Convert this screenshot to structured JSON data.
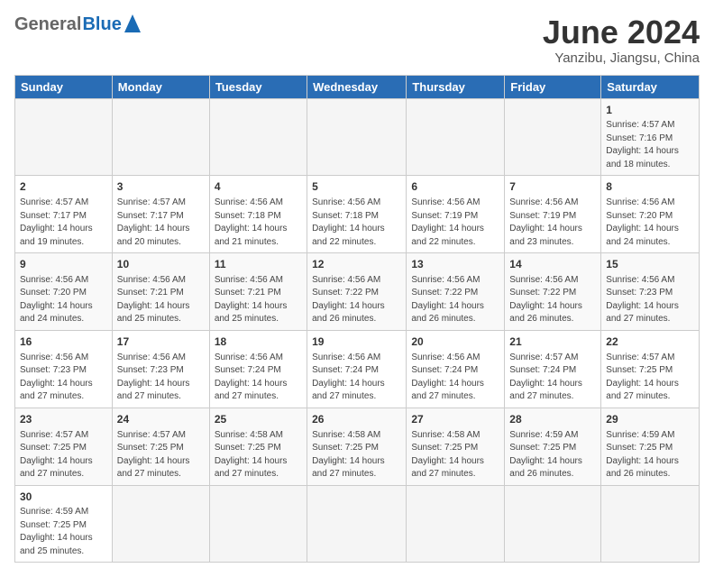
{
  "header": {
    "logo_general": "General",
    "logo_blue": "Blue",
    "title": "June 2024",
    "location": "Yanzibu, Jiangsu, China"
  },
  "days_of_week": [
    "Sunday",
    "Monday",
    "Tuesday",
    "Wednesday",
    "Thursday",
    "Friday",
    "Saturday"
  ],
  "weeks": [
    {
      "days": [
        {
          "num": "",
          "info": ""
        },
        {
          "num": "",
          "info": ""
        },
        {
          "num": "",
          "info": ""
        },
        {
          "num": "",
          "info": ""
        },
        {
          "num": "",
          "info": ""
        },
        {
          "num": "",
          "info": ""
        },
        {
          "num": "1",
          "info": "Sunrise: 4:57 AM\nSunset: 7:16 PM\nDaylight: 14 hours\nand 18 minutes."
        }
      ]
    },
    {
      "days": [
        {
          "num": "2",
          "info": "Sunrise: 4:57 AM\nSunset: 7:17 PM\nDaylight: 14 hours\nand 19 minutes."
        },
        {
          "num": "3",
          "info": "Sunrise: 4:57 AM\nSunset: 7:17 PM\nDaylight: 14 hours\nand 20 minutes."
        },
        {
          "num": "4",
          "info": "Sunrise: 4:56 AM\nSunset: 7:18 PM\nDaylight: 14 hours\nand 21 minutes."
        },
        {
          "num": "5",
          "info": "Sunrise: 4:56 AM\nSunset: 7:18 PM\nDaylight: 14 hours\nand 22 minutes."
        },
        {
          "num": "6",
          "info": "Sunrise: 4:56 AM\nSunset: 7:19 PM\nDaylight: 14 hours\nand 22 minutes."
        },
        {
          "num": "7",
          "info": "Sunrise: 4:56 AM\nSunset: 7:19 PM\nDaylight: 14 hours\nand 23 minutes."
        },
        {
          "num": "8",
          "info": "Sunrise: 4:56 AM\nSunset: 7:20 PM\nDaylight: 14 hours\nand 24 minutes."
        }
      ]
    },
    {
      "days": [
        {
          "num": "9",
          "info": "Sunrise: 4:56 AM\nSunset: 7:20 PM\nDaylight: 14 hours\nand 24 minutes."
        },
        {
          "num": "10",
          "info": "Sunrise: 4:56 AM\nSunset: 7:21 PM\nDaylight: 14 hours\nand 25 minutes."
        },
        {
          "num": "11",
          "info": "Sunrise: 4:56 AM\nSunset: 7:21 PM\nDaylight: 14 hours\nand 25 minutes."
        },
        {
          "num": "12",
          "info": "Sunrise: 4:56 AM\nSunset: 7:22 PM\nDaylight: 14 hours\nand 26 minutes."
        },
        {
          "num": "13",
          "info": "Sunrise: 4:56 AM\nSunset: 7:22 PM\nDaylight: 14 hours\nand 26 minutes."
        },
        {
          "num": "14",
          "info": "Sunrise: 4:56 AM\nSunset: 7:22 PM\nDaylight: 14 hours\nand 26 minutes."
        },
        {
          "num": "15",
          "info": "Sunrise: 4:56 AM\nSunset: 7:23 PM\nDaylight: 14 hours\nand 27 minutes."
        }
      ]
    },
    {
      "days": [
        {
          "num": "16",
          "info": "Sunrise: 4:56 AM\nSunset: 7:23 PM\nDaylight: 14 hours\nand 27 minutes."
        },
        {
          "num": "17",
          "info": "Sunrise: 4:56 AM\nSunset: 7:23 PM\nDaylight: 14 hours\nand 27 minutes."
        },
        {
          "num": "18",
          "info": "Sunrise: 4:56 AM\nSunset: 7:24 PM\nDaylight: 14 hours\nand 27 minutes."
        },
        {
          "num": "19",
          "info": "Sunrise: 4:56 AM\nSunset: 7:24 PM\nDaylight: 14 hours\nand 27 minutes."
        },
        {
          "num": "20",
          "info": "Sunrise: 4:56 AM\nSunset: 7:24 PM\nDaylight: 14 hours\nand 27 minutes."
        },
        {
          "num": "21",
          "info": "Sunrise: 4:57 AM\nSunset: 7:24 PM\nDaylight: 14 hours\nand 27 minutes."
        },
        {
          "num": "22",
          "info": "Sunrise: 4:57 AM\nSunset: 7:25 PM\nDaylight: 14 hours\nand 27 minutes."
        }
      ]
    },
    {
      "days": [
        {
          "num": "23",
          "info": "Sunrise: 4:57 AM\nSunset: 7:25 PM\nDaylight: 14 hours\nand 27 minutes."
        },
        {
          "num": "24",
          "info": "Sunrise: 4:57 AM\nSunset: 7:25 PM\nDaylight: 14 hours\nand 27 minutes."
        },
        {
          "num": "25",
          "info": "Sunrise: 4:58 AM\nSunset: 7:25 PM\nDaylight: 14 hours\nand 27 minutes."
        },
        {
          "num": "26",
          "info": "Sunrise: 4:58 AM\nSunset: 7:25 PM\nDaylight: 14 hours\nand 27 minutes."
        },
        {
          "num": "27",
          "info": "Sunrise: 4:58 AM\nSunset: 7:25 PM\nDaylight: 14 hours\nand 27 minutes."
        },
        {
          "num": "28",
          "info": "Sunrise: 4:59 AM\nSunset: 7:25 PM\nDaylight: 14 hours\nand 26 minutes."
        },
        {
          "num": "29",
          "info": "Sunrise: 4:59 AM\nSunset: 7:25 PM\nDaylight: 14 hours\nand 26 minutes."
        }
      ]
    },
    {
      "days": [
        {
          "num": "30",
          "info": "Sunrise: 4:59 AM\nSunset: 7:25 PM\nDaylight: 14 hours\nand 25 minutes."
        },
        {
          "num": "",
          "info": ""
        },
        {
          "num": "",
          "info": ""
        },
        {
          "num": "",
          "info": ""
        },
        {
          "num": "",
          "info": ""
        },
        {
          "num": "",
          "info": ""
        },
        {
          "num": "",
          "info": ""
        }
      ]
    }
  ]
}
